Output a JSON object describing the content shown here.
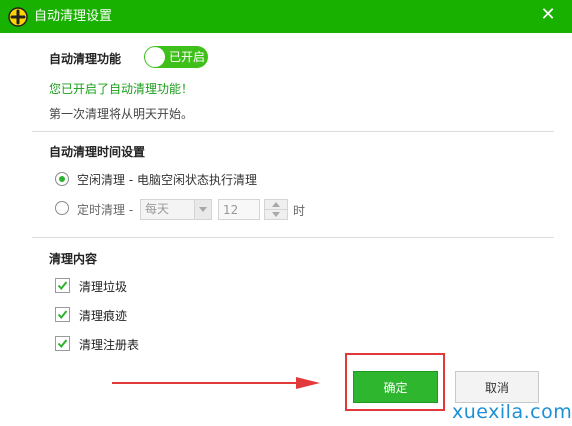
{
  "window": {
    "title": "自动清理设置",
    "close_label": "✕",
    "logo_icon": "360-cleaner-logo"
  },
  "auto_clean": {
    "label": "自动清理功能",
    "toggle_text": "已开启",
    "toggle_on": true,
    "status_text": "您已开启了自动清理功能！",
    "info_text": "第一次清理将从明天开始。"
  },
  "schedule": {
    "heading": "自动清理时间设置",
    "options": [
      {
        "label": "空闲清理 - 电脑空闲状态执行清理",
        "selected": true
      },
      {
        "label": "定时清理 -",
        "selected": false
      }
    ],
    "frequency_value": "每天",
    "hour_value": "12",
    "unit_label": "时"
  },
  "content": {
    "heading": "清理内容",
    "items": [
      {
        "label": "清理垃圾",
        "checked": true
      },
      {
        "label": "清理痕迹",
        "checked": true
      },
      {
        "label": "清理注册表",
        "checked": true
      }
    ]
  },
  "buttons": {
    "ok_label": "确定",
    "cancel_label": "取消"
  },
  "watermark": "xuexila.com",
  "colors": {
    "titlebar": "#19b100",
    "accent_green": "#2eb72e",
    "status_green": "#1a9e1a",
    "annotation_red": "#e23a3a",
    "watermark_blue": "#1c8fd6"
  }
}
